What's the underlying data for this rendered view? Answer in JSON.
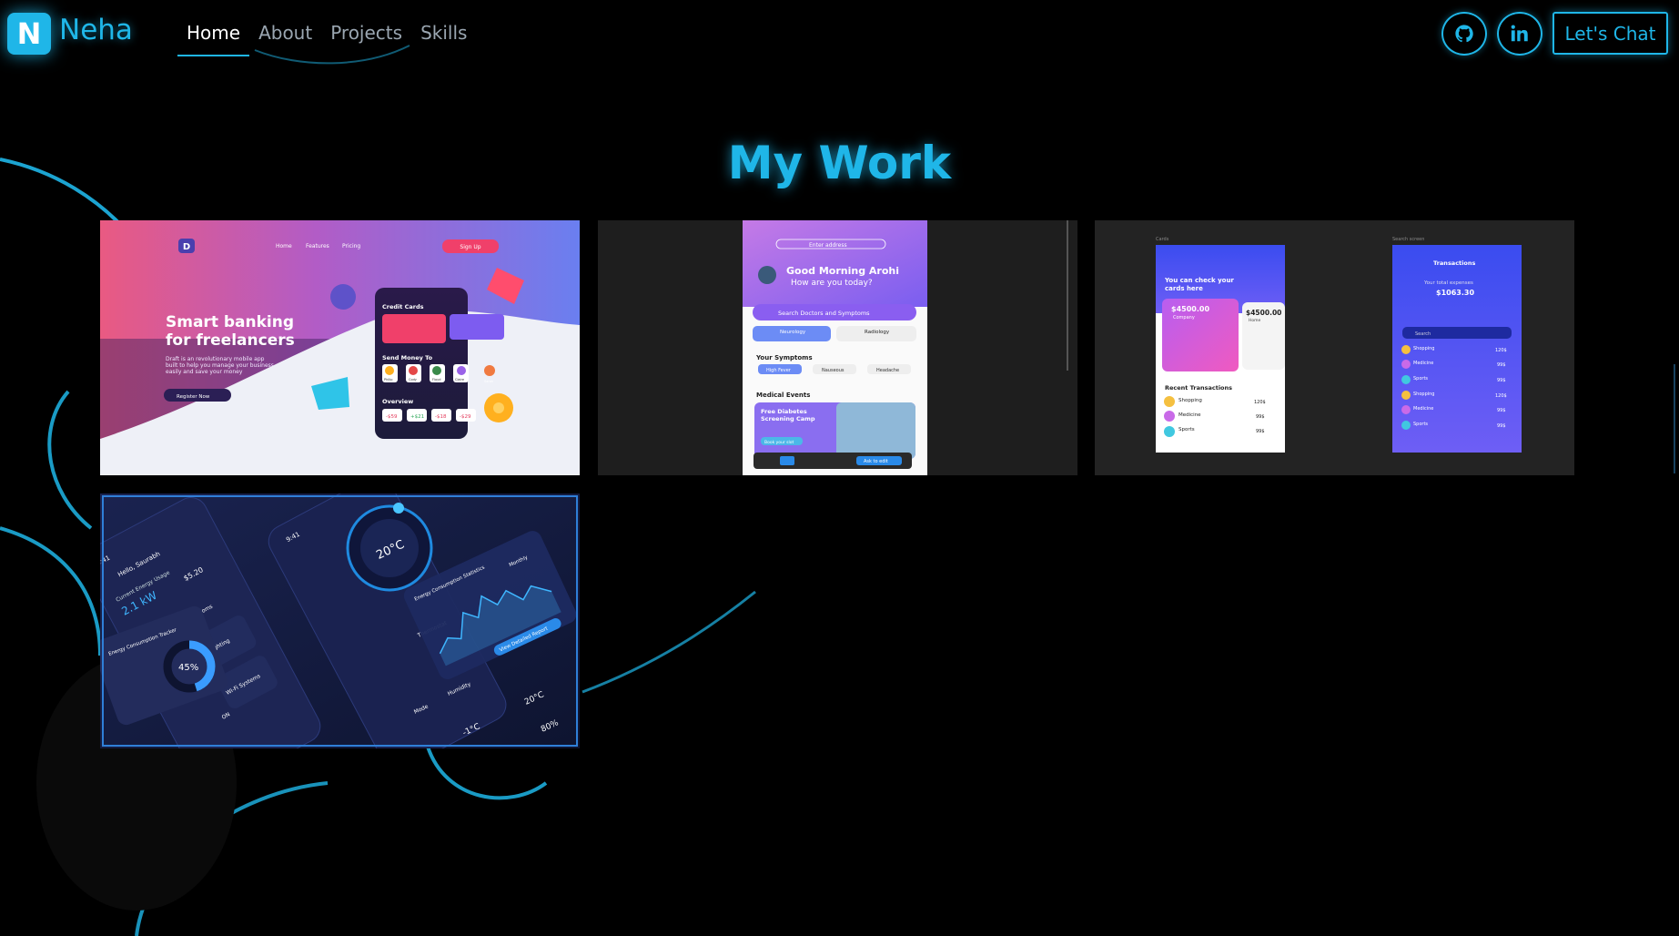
{
  "brand": {
    "initial": "N",
    "name": "Neha"
  },
  "nav": {
    "links": [
      {
        "label": "Home",
        "active": true
      },
      {
        "label": "About",
        "active": false
      },
      {
        "label": "Projects",
        "active": false
      },
      {
        "label": "Skills",
        "active": false
      }
    ],
    "social": [
      {
        "icon": "github-icon"
      },
      {
        "icon": "linkedin-icon"
      }
    ],
    "cta_label": "Let's Chat"
  },
  "section": {
    "title": "My Work"
  },
  "projects": [
    {
      "name": "banking-landing",
      "logo": "D",
      "menu": [
        "Home",
        "Features",
        "Pricing"
      ],
      "signup": "Sign Up",
      "headline_1": "Smart banking",
      "headline_2": "for freelancers",
      "sub_1": "Draft is an revolutionary mobile app",
      "sub_2": "built to help you manage your business",
      "sub_3": "easily and save your money",
      "register": "Register Now",
      "phone_cards": "Credit Cards",
      "phone_send": "Send Money To",
      "phone_people": [
        "Philip",
        "Cody",
        "Floyd",
        "Claire",
        "Sarah"
      ],
      "phone_overview": "Overview",
      "phone_amounts": [
        "-$59",
        "+$21",
        "-$18",
        "-$29"
      ]
    },
    {
      "name": "medical-app",
      "address": "Enter address",
      "greeting": "Good Morning Arohi",
      "question": "How are you today?",
      "search": "Search Doctors and Symptoms",
      "dept_1": "Neurology",
      "dept_2": "Radiology",
      "symptoms_title": "Your Symptoms",
      "symptoms": [
        "High Fever",
        "Nauseous",
        "Headache"
      ],
      "events_title": "Medical Events",
      "event_1": "Free Diabetes",
      "event_2": "Screening Camp",
      "event_cta": "Book your slot",
      "toolbar_cta": "Ask to edit"
    },
    {
      "name": "finance-app",
      "screen_1_label": "Cards",
      "screen_2_label": "Search screen",
      "cards_heading_1": "You can check your",
      "cards_heading_2": "cards here",
      "card_amount": "$4500.00",
      "card_1_label": "Company",
      "card_2_label": "Home",
      "recent": "Recent Transactions",
      "transactions": [
        {
          "label": "Shopping",
          "amount": "120$"
        },
        {
          "label": "Medicine",
          "amount": "99$"
        },
        {
          "label": "Sports",
          "amount": "99$"
        }
      ],
      "tx_title": "Transactions",
      "total_label": "Your total expenses",
      "total": "$1063.30",
      "search": "Search",
      "tx_list": [
        {
          "label": "Shopping",
          "amount": "120$"
        },
        {
          "label": "Medicine",
          "amount": "99$"
        },
        {
          "label": "Sports",
          "amount": "99$"
        },
        {
          "label": "Shopping",
          "amount": "120$"
        },
        {
          "label": "Medicine",
          "amount": "99$"
        },
        {
          "label": "Sports",
          "amount": "99$"
        }
      ]
    },
    {
      "name": "energy-app",
      "greeting": "Hello, Saurabh",
      "usage_label": "Current Energy Usage",
      "usage": "2.1 kW",
      "cost": "$5.20",
      "temp": "20°C",
      "stats_title": "Energy Consumption Statistics",
      "period": "Monthly",
      "tracker": "Energy Consumption Tracker",
      "percent": "45%",
      "rooms": "Rooms",
      "lighting": "Lighting",
      "wifi": "Wi-Fi Systems",
      "on": "ON",
      "thermostat": "Thermostat",
      "mode": "Mode",
      "humidity": "Humidity",
      "outdoor_temp": "-1°C",
      "current_temp": "20°C",
      "battery": "80%",
      "report": "View Detailed Report",
      "time": "9:41"
    }
  ]
}
